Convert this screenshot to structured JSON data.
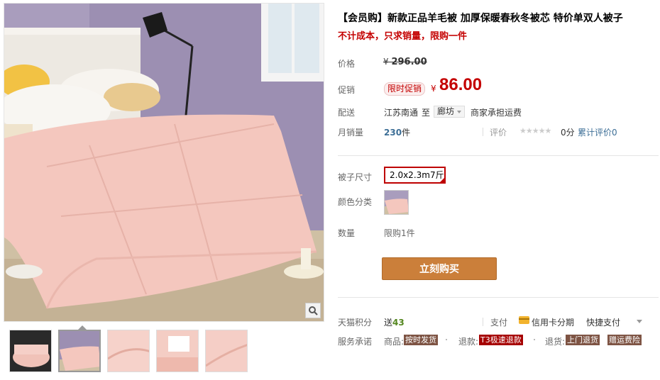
{
  "product": {
    "title": "【会员购】新款正品羊毛被 加厚保暖春秋冬被芯 特价单双人被子",
    "subtitle": "不计成本，只求销量，限购一件"
  },
  "price": {
    "label": "价格",
    "currency": "¥",
    "original": "296.00"
  },
  "promo": {
    "label": "促销",
    "tag": "限时促销",
    "currency": "¥",
    "price": "86.00"
  },
  "shipping": {
    "label": "配送",
    "from": "江苏南通",
    "to_word": "至",
    "dest": "廊坊",
    "fee_note": "商家承担运费"
  },
  "sales": {
    "label": "月销量",
    "count": "230",
    "unit": "件",
    "rating_label": "评价",
    "stars": "★★★★★",
    "score": "0分",
    "cumulative": "累计评价0"
  },
  "options": {
    "size_label": "被子尺寸",
    "size_value": "2.0x2.3m7斤",
    "color_label": "颜色分类"
  },
  "quantity": {
    "label": "数量",
    "limit": "限购1件"
  },
  "buy_button": "立刻购买",
  "tmall": {
    "points_label": "天猫积分",
    "points_prefix": "送",
    "points_value": "43",
    "pay_label": "支付",
    "credit": "信用卡分期",
    "quick": "快捷支付"
  },
  "service": {
    "label": "服务承诺",
    "goods_label": "商品:",
    "goods_badge": "按时发货",
    "refund_label": "退款:",
    "refund_badge": "T3极速退款",
    "return_label": "退货:",
    "return_badge": "上门退货",
    "insurance_badge": "赠运费险"
  },
  "colors": {
    "accent_red": "#c40000",
    "buy_button": "#cb7f3a",
    "points_green": "#53861e",
    "link_blue": "#3c6e96"
  }
}
